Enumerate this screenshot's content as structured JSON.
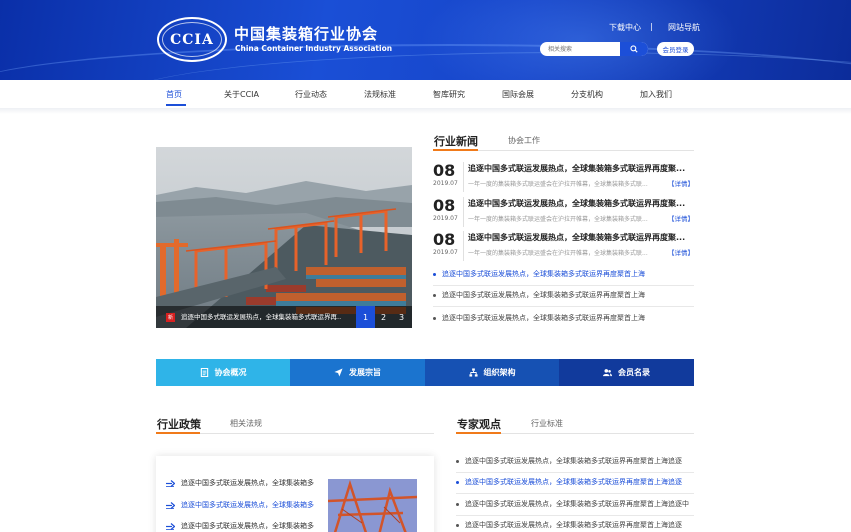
{
  "header": {
    "logo_text": "CCIA",
    "title_cn": "中国集装箱行业协会",
    "title_en": "China Container Industry Association",
    "download_link": "下载中心",
    "separator": "|",
    "sitemap_link": "网站导航",
    "search_placeholder": "相关搜索",
    "login_button": "会员登录"
  },
  "nav": {
    "items": [
      "首页",
      "关于CCIA",
      "行业动态",
      "法规标准",
      "智库研究",
      "国际会展",
      "分支机构",
      "加入我们"
    ],
    "active_index": 0
  },
  "carousel": {
    "tag": "新",
    "caption": "追逐中国多式联运发展热点，全球集装箱多式联运界再...",
    "pages": [
      "1",
      "2",
      "3"
    ],
    "active_page": 0
  },
  "industry_news": {
    "title": "行业新闻",
    "other_tab": "协会工作",
    "dated": [
      {
        "day": "08",
        "ym": "2019.07",
        "title": "追逐中国多式联运发展热点，全球集装箱多式联运界再度聚...",
        "desc": "一年一度的集装箱多式联运盛会在沪拉开帷幕，全球集装箱多式联...",
        "more": "【详情】"
      },
      {
        "day": "08",
        "ym": "2019.07",
        "title": "追逐中国多式联运发展热点，全球集装箱多式联运界再度聚...",
        "desc": "一年一度的集装箱多式联运盛会在沪拉开帷幕，全球集装箱多式联...",
        "more": "【详情】"
      },
      {
        "day": "08",
        "ym": "2019.07",
        "title": "追逐中国多式联运发展热点，全球集装箱多式联运界再度聚...",
        "desc": "一年一度的集装箱多式联运盛会在沪拉开帷幕，全球集装箱多式联...",
        "more": "【详情】"
      }
    ],
    "list": [
      "追逐中国多式联运发展热点，全球集装箱多式联运界再度聚首上海",
      "追逐中国多式联运发展热点，全球集装箱多式联运界再度聚首上海",
      "追逐中国多式联运发展热点，全球集装箱多式联运界再度聚首上海"
    ]
  },
  "quick_links": [
    {
      "label": "协会概况",
      "color": "#2fb4e8",
      "icon": "document-icon"
    },
    {
      "label": "发展宗旨",
      "color": "#1b74cf",
      "icon": "send-icon"
    },
    {
      "label": "组织架构",
      "color": "#1651b3",
      "icon": "org-chart-icon"
    },
    {
      "label": "会员名录",
      "color": "#113a9c",
      "icon": "users-icon"
    }
  ],
  "policy": {
    "title": "行业政策",
    "other_tab": "相关法规",
    "items": [
      "追逐中国多式联运发展热点，全球集装箱多",
      "追逐中国多式联运发展热点，全球集装箱多",
      "追逐中国多式联运发展热点，全球集装箱多"
    ]
  },
  "opinion": {
    "title": "专家观点",
    "other_tab": "行业标准",
    "items": [
      "追逐中国多式联运发展热点，全球集装箱多式联运界再度聚首上海追逐",
      "追逐中国多式联运发展热点，全球集装箱多式联运界再度聚首上海追逐",
      "追逐中国多式联运发展热点，全球集装箱多式联运界再度聚首上海追逐中",
      "追逐中国多式联运发展热点，全球集装箱多式联运界再度聚首上海追逐"
    ]
  }
}
